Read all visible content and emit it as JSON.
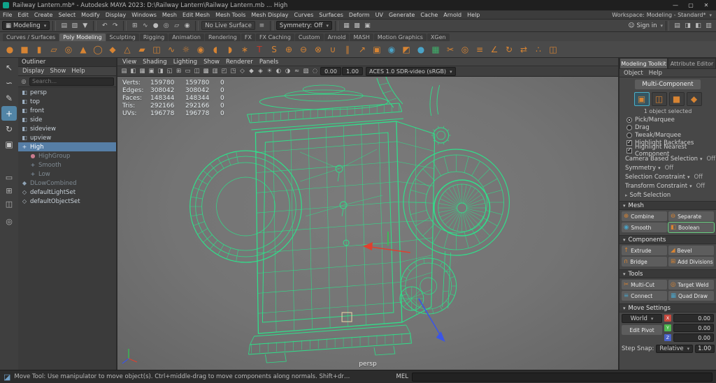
{
  "colors": {
    "wire": "#2fe08a",
    "selection": "#5285a6",
    "axis_x": "#e0402e",
    "axis_y": "#2fca4f",
    "axis_z": "#3b55e6",
    "manip_square": "#d9caa0",
    "icon_orange": "#d78433",
    "icon_teal": "#4aa3c7"
  },
  "window": {
    "title": "Railway Lantern.mb* - Autodesk MAYA 2023: D:\\Railway Lantern\\Railway Lantern.mb   ...   High",
    "controls": [
      {
        "name": "minimize-button",
        "glyph": "—"
      },
      {
        "name": "maximize-button",
        "glyph": "▢"
      },
      {
        "name": "close-button",
        "glyph": "✕"
      }
    ]
  },
  "menubar": {
    "items": [
      "File",
      "Edit",
      "Create",
      "Select",
      "Modify",
      "Display",
      "Windows",
      "Mesh",
      "Edit Mesh",
      "Mesh Tools",
      "Mesh Display",
      "Curves",
      "Surfaces",
      "Deform",
      "UV",
      "Generate",
      "Cache",
      "Arnold",
      "Help"
    ],
    "workspace_label": "Workspace:",
    "workspace_value": "Modeling - Standard*"
  },
  "statusline": {
    "mode": "Modeling",
    "mode_icon": "▦",
    "file_icons": [
      {
        "name": "new-scene-icon",
        "glyph": "▤"
      },
      {
        "name": "open-scene-icon",
        "glyph": "▧"
      },
      {
        "name": "save-scene-icon",
        "glyph": "▼"
      }
    ],
    "undo_redo": [
      {
        "name": "undo-icon",
        "glyph": "↶"
      },
      {
        "name": "redo-icon",
        "glyph": "↷"
      }
    ],
    "snap_icons": [
      {
        "name": "snap-grid-icon",
        "glyph": "⊞"
      },
      {
        "name": "snap-curve-icon",
        "glyph": "∿"
      },
      {
        "name": "snap-point-icon",
        "glyph": "●"
      },
      {
        "name": "snap-projected-center-icon",
        "glyph": "◎"
      },
      {
        "name": "snap-view-plane-icon",
        "glyph": "▱"
      },
      {
        "name": "make-live-icon",
        "glyph": "◉"
      }
    ],
    "no_live_surface": "No Live Surface",
    "history_icons": [
      {
        "name": "construction-history-icon",
        "glyph": "≡"
      }
    ],
    "symmetry": "Symmetry: Off",
    "render_icons": [
      {
        "name": "render-current-frame-icon",
        "glyph": "▦"
      },
      {
        "name": "ipr-render-icon",
        "glyph": "▩"
      },
      {
        "name": "render-settings-icon",
        "glyph": "▣"
      }
    ],
    "sign_in_icon": "☺",
    "sign_in": "Sign in",
    "right_toggles": [
      {
        "name": "outliner-toggle-icon",
        "glyph": "▤"
      },
      {
        "name": "tool-settings-toggle-icon",
        "glyph": "◨"
      },
      {
        "name": "attribute-editor-toggle-icon",
        "glyph": "◧"
      },
      {
        "name": "channel-box-toggle-icon",
        "glyph": "▥"
      }
    ]
  },
  "shelf": {
    "tabs": [
      {
        "label": "Curves / Surfaces"
      },
      {
        "label": "Poly Modeling",
        "active": true
      },
      {
        "label": "Sculpting"
      },
      {
        "label": "Rigging"
      },
      {
        "label": "Animation"
      },
      {
        "label": "Rendering"
      },
      {
        "label": "FX"
      },
      {
        "label": "FX Caching"
      },
      {
        "label": "Custom"
      },
      {
        "label": "Arnold"
      },
      {
        "label": "MASH"
      },
      {
        "label": "Motion Graphics"
      },
      {
        "label": "XGen"
      }
    ],
    "icons": [
      {
        "name": "poly-sphere-icon",
        "glyph": "●",
        "color": "#d78433"
      },
      {
        "name": "poly-cube-icon",
        "glyph": "■",
        "color": "#d78433"
      },
      {
        "name": "poly-cylinder-icon",
        "glyph": "▮",
        "color": "#d78433"
      },
      {
        "name": "poly-plane-icon",
        "glyph": "▱",
        "color": "#d78433"
      },
      {
        "name": "poly-torus-icon",
        "glyph": "◎",
        "color": "#d78433"
      },
      {
        "name": "poly-cone-icon",
        "glyph": "▲",
        "color": "#d78433"
      },
      {
        "name": "poly-disc-icon",
        "glyph": "◯",
        "color": "#d78433"
      },
      {
        "name": "poly-platonic-icon",
        "glyph": "◆",
        "color": "#d78433"
      },
      {
        "name": "poly-pyramid-icon",
        "glyph": "△",
        "color": "#d78433"
      },
      {
        "name": "poly-prism-icon",
        "glyph": "▰",
        "color": "#d78433"
      },
      {
        "name": "poly-pipe-icon",
        "glyph": "◫",
        "color": "#d78433"
      },
      {
        "name": "poly-helix-icon",
        "glyph": "∿",
        "color": "#d78433"
      },
      {
        "name": "poly-gear-icon",
        "glyph": "☼",
        "color": "#d78433"
      },
      {
        "name": "poly-soccer-ball-icon",
        "glyph": "◉",
        "color": "#d78433"
      },
      {
        "name": "super-ellipse-icon",
        "glyph": "◖",
        "color": "#d78433"
      },
      {
        "name": "spherical-harmonics-icon",
        "glyph": "◗",
        "color": "#d78433"
      },
      {
        "name": "ultra-shape-icon",
        "glyph": "∗",
        "color": "#d78433"
      },
      {
        "name": "type-tool-icon",
        "glyph": "T",
        "color": "#c0392b"
      },
      {
        "name": "svg-tool-icon",
        "glyph": "S",
        "color": "#d78433"
      },
      {
        "name": "boolean-union-icon",
        "glyph": "⊕",
        "color": "#d78433"
      },
      {
        "name": "boolean-difference-icon",
        "glyph": "⊖",
        "color": "#d78433"
      },
      {
        "name": "boolean-intersection-icon",
        "glyph": "⊗",
        "color": "#d78433"
      },
      {
        "name": "combine-icon",
        "glyph": "∪",
        "color": "#d78433"
      },
      {
        "name": "separate-icon",
        "glyph": "∥",
        "color": "#d78433"
      },
      {
        "name": "extract-icon",
        "glyph": "↗",
        "color": "#d78433"
      },
      {
        "name": "fill-hole-icon",
        "glyph": "▣",
        "color": "#d78433"
      },
      {
        "name": "smooth-icon",
        "glyph": "◉",
        "color": "#4aa3c7"
      },
      {
        "name": "append-polygon-icon",
        "glyph": "◩",
        "color": "#d78433"
      },
      {
        "name": "sculpt-tool-icon",
        "glyph": "●",
        "color": "#4aa3c7"
      },
      {
        "name": "quad-draw-icon",
        "glyph": "▦",
        "color": "#3fae6a"
      },
      {
        "name": "multi-cut-icon",
        "glyph": "✂",
        "color": "#d78433"
      },
      {
        "name": "target-weld-icon",
        "glyph": "◎",
        "color": "#d78433"
      },
      {
        "name": "connect-icon",
        "glyph": "≡",
        "color": "#d78433"
      },
      {
        "name": "crease-tool-icon",
        "glyph": "∠",
        "color": "#d78433"
      },
      {
        "name": "spin-edge-icon",
        "glyph": "↻",
        "color": "#d78433"
      },
      {
        "name": "symmetrize-icon",
        "glyph": "⇄",
        "color": "#d78433"
      },
      {
        "name": "average-vertices-icon",
        "glyph": "∴",
        "color": "#d78433"
      },
      {
        "name": "mirror-icon",
        "glyph": "◫",
        "color": "#d78433"
      }
    ]
  },
  "toolbox": {
    "tools": [
      {
        "name": "select-tool-icon",
        "glyph": "↖"
      },
      {
        "name": "lasso-tool-icon",
        "glyph": "∽"
      },
      {
        "name": "paint-select-tool-icon",
        "glyph": "✎"
      },
      {
        "name": "move-tool-icon",
        "glyph": "+",
        "active": true
      },
      {
        "name": "rotate-tool-icon",
        "glyph": "↻"
      },
      {
        "name": "scale-tool-icon",
        "glyph": "▣"
      }
    ],
    "layouts": [
      {
        "name": "single-pane-layout-icon",
        "glyph": "▭"
      },
      {
        "name": "four-pane-layout-icon",
        "glyph": "⊞"
      },
      {
        "name": "two-pane-layout-icon",
        "glyph": "◫"
      }
    ],
    "magnifier_glyph": "◎"
  },
  "outliner": {
    "title": "Outliner",
    "menus": [
      "Display",
      "Show",
      "Help"
    ],
    "search_placeholder": "Search...",
    "items": [
      {
        "label": "persp",
        "glyph": "◧",
        "color": "#9fb2c4"
      },
      {
        "label": "top",
        "glyph": "◧",
        "color": "#9fb2c4"
      },
      {
        "label": "front",
        "glyph": "◧",
        "color": "#9fb2c4"
      },
      {
        "label": "side",
        "glyph": "◧",
        "color": "#9fb2c4"
      },
      {
        "label": "sideview",
        "glyph": "◧",
        "color": "#9fb2c4"
      },
      {
        "label": "upview",
        "glyph": "◧",
        "color": "#9fb2c4"
      },
      {
        "label": "High",
        "glyph": "+",
        "color": "#e8f0f6",
        "selected": true
      },
      {
        "label": "HighGroup",
        "glyph": "●",
        "color": "#c97b8e",
        "dim": true,
        "level": 1
      },
      {
        "label": "Smooth",
        "glyph": "+",
        "color": "#8fa3b5",
        "dim": true,
        "level": 1
      },
      {
        "label": "Low",
        "glyph": "+",
        "color": "#8fa3b5",
        "dim": true,
        "level": 1
      },
      {
        "label": "DLowCombined",
        "glyph": "◆",
        "color": "#8fa3b5",
        "dim": true
      },
      {
        "label": "defaultLightSet",
        "glyph": "◇",
        "color": "#b9c4cc"
      },
      {
        "label": "defaultObjectSet",
        "glyph": "◇",
        "color": "#b9c4cc"
      }
    ]
  },
  "viewport": {
    "menus": [
      "View",
      "Shading",
      "Lighting",
      "Show",
      "Renderer",
      "Panels"
    ],
    "toolbar_icons": [
      {
        "name": "select-camera-icon",
        "glyph": "▤"
      },
      {
        "name": "lock-camera-icon",
        "glyph": "◧"
      },
      {
        "name": "camera-attributes-icon",
        "glyph": "▦"
      },
      {
        "name": "bookmarks-icon",
        "glyph": "▣"
      },
      {
        "name": "image-plane-icon",
        "glyph": "◨"
      },
      {
        "name": "two-d-pan-zoom-icon",
        "glyph": "◱"
      },
      {
        "name": "grid-toggle-icon",
        "glyph": "⊞"
      },
      {
        "name": "film-gate-icon",
        "glyph": "▭"
      },
      {
        "name": "resolution-gate-icon",
        "glyph": "◫"
      },
      {
        "name": "gate-mask-icon",
        "glyph": "▩"
      },
      {
        "name": "field-chart-icon",
        "glyph": "▥"
      },
      {
        "name": "safe-action-icon",
        "glyph": "◰"
      },
      {
        "name": "safe-title-icon",
        "glyph": "◳"
      },
      {
        "name": "wireframe-mode-icon",
        "glyph": "◇"
      },
      {
        "name": "shaded-mode-icon",
        "glyph": "◆"
      },
      {
        "name": "textured-mode-icon",
        "glyph": "◈"
      },
      {
        "name": "lights-icon",
        "glyph": "☀"
      },
      {
        "name": "shadows-icon",
        "glyph": "◐"
      },
      {
        "name": "ambient-occlusion-icon",
        "glyph": "◑"
      },
      {
        "name": "motion-blur-icon",
        "glyph": "≈"
      },
      {
        "name": "anti-alias-icon",
        "glyph": "▧"
      },
      {
        "name": "xray-icon",
        "glyph": "◌"
      }
    ],
    "exposure": "0.00",
    "gamma": "1.00",
    "colorspace": "ACES 1.0 SDR-video (sRGB)",
    "hud_rows": [
      {
        "label": "Verts:",
        "a": "159780",
        "b": "159780",
        "c": "0"
      },
      {
        "label": "Edges:",
        "a": "308042",
        "b": "308042",
        "c": "0"
      },
      {
        "label": "Faces:",
        "a": "148344",
        "b": "148344",
        "c": "0"
      },
      {
        "label": "Tris:",
        "a": "292166",
        "b": "292166",
        "c": "0"
      },
      {
        "label": "UVs:",
        "a": "196778",
        "b": "196778",
        "c": "0"
      }
    ],
    "camera_label": "persp"
  },
  "toolkit": {
    "tabs": [
      {
        "label": "Modeling Toolkit",
        "active": true
      },
      {
        "label": "Attribute Editor"
      }
    ],
    "menus": [
      "Object",
      "Help"
    ],
    "multi_component": "Multi-Component",
    "component_modes": [
      {
        "name": "vertex-mode-icon",
        "glyph": "▣",
        "active": true
      },
      {
        "name": "edge-mode-icon",
        "glyph": "◫"
      },
      {
        "name": "face-mode-icon",
        "glyph": "■"
      },
      {
        "name": "uv-mode-icon",
        "glyph": "◆"
      }
    ],
    "selection_status": "1 object selected",
    "selection_modes": [
      {
        "label": "Pick/Marquee",
        "checked": true
      },
      {
        "label": "Drag"
      },
      {
        "label": "Tweak/Marquee"
      }
    ],
    "highlight_options": [
      {
        "label": "Highlight Backfaces",
        "checked": true
      },
      {
        "label": "Highlight Nearest Component",
        "checked": true
      }
    ],
    "constraint_rows": [
      {
        "label": "Camera Based Selection",
        "value": "Off"
      },
      {
        "label": "Symmetry",
        "value": "Off"
      },
      {
        "label": "Selection Constraint",
        "value": "Off"
      },
      {
        "label": "Transform Constraint",
        "value": "Off"
      }
    ],
    "soft_selection": "Soft Selection",
    "mesh": {
      "title": "Mesh",
      "buttons": [
        {
          "label": "Combine",
          "glyph": "⊕",
          "color": "#d78433"
        },
        {
          "label": "Separate",
          "glyph": "⊖",
          "color": "#d78433"
        },
        {
          "label": "Smooth",
          "glyph": "◉",
          "color": "#4aa3c7"
        },
        {
          "label": "Boolean",
          "glyph": "◧",
          "color": "#d78433",
          "highlight": true
        }
      ]
    },
    "components": {
      "title": "Components",
      "buttons": [
        {
          "label": "Extrude",
          "glyph": "↑",
          "color": "#d78433"
        },
        {
          "label": "Bevel",
          "glyph": "◢",
          "color": "#d78433"
        },
        {
          "label": "Bridge",
          "glyph": "∩",
          "color": "#d78433"
        },
        {
          "label": "Add Divisions",
          "glyph": "⊞",
          "color": "#d78433"
        }
      ]
    },
    "tools": {
      "title": "Tools",
      "buttons": [
        {
          "label": "Multi-Cut",
          "glyph": "✂",
          "color": "#d78433"
        },
        {
          "label": "Target Weld",
          "glyph": "◎",
          "color": "#d78433"
        },
        {
          "label": "Connect",
          "glyph": "≡",
          "color": "#4aa3c7"
        },
        {
          "label": "Quad Draw",
          "glyph": "▦",
          "color": "#4aa3c7"
        }
      ]
    },
    "move": {
      "title": "Move Settings",
      "axis_label": "World",
      "axes": [
        {
          "axis": "X",
          "color": "#c84a3f",
          "value": "0.00"
        },
        {
          "axis": "Y",
          "color": "#4fb84f",
          "value": "0.00"
        },
        {
          "axis": "Z",
          "color": "#4a62c8",
          "value": "0.00"
        }
      ],
      "edit_pivot": "Edit Pivot",
      "step_label": "Step Snap:",
      "step_mode": "Relative",
      "step_value": "1.00"
    }
  },
  "helpline": {
    "icon_glyph": "◪",
    "text": "Move Tool: Use manipulator to move object(s). Ctrl+middle-drag to move components along normals. Shift+drag manipulator axis or plane handles to extrude components or clone objects. Ctrl+Shift+drag to c",
    "mel_label": "MEL"
  }
}
